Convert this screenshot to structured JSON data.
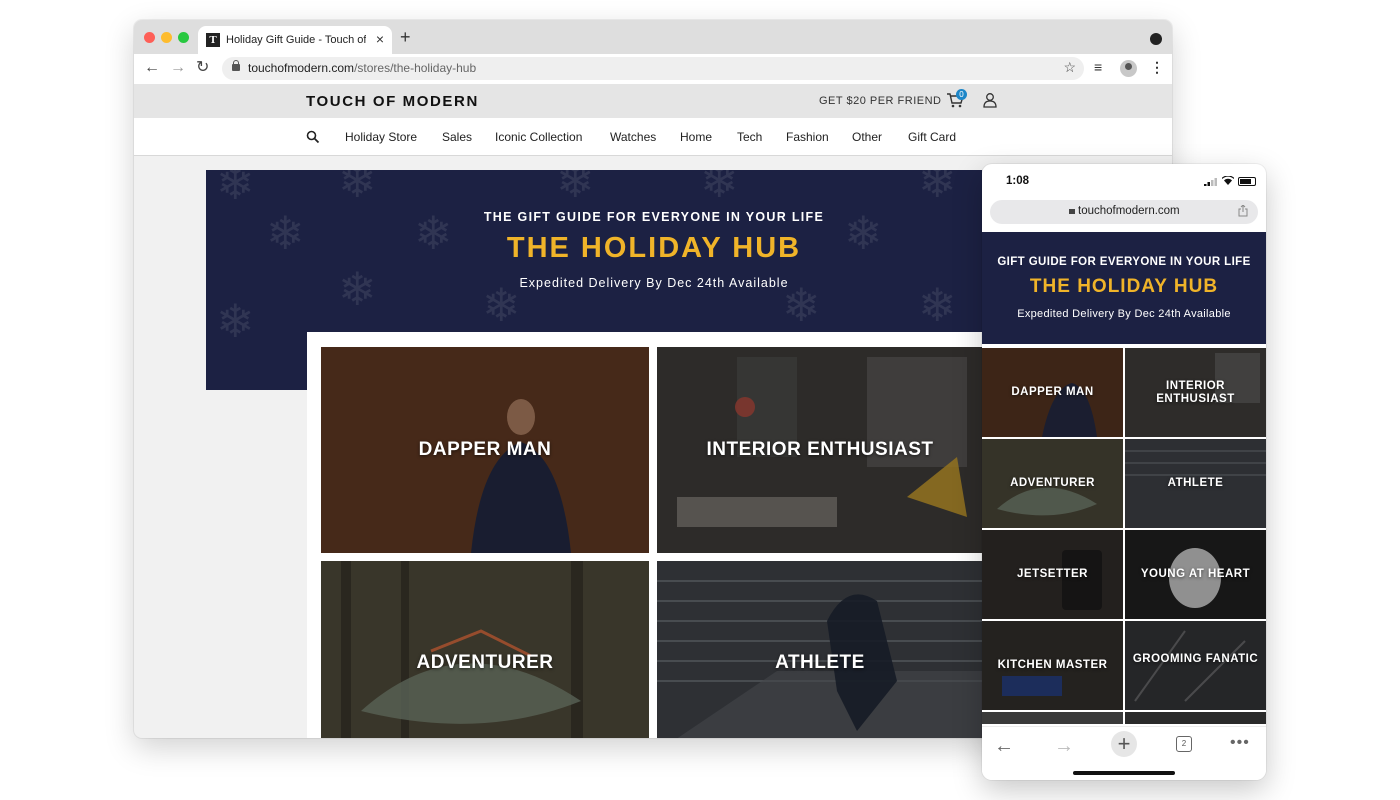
{
  "browser": {
    "tab_title": "Holiday Gift Guide - Touch of M",
    "tab_favicon": "T",
    "url_domain": "touchofmodern.com",
    "url_path": "/stores/the-holiday-hub"
  },
  "site": {
    "logo": "TOUCH OF MODERN",
    "referral": "GET $20 PER FRIEND",
    "cart_count": "0",
    "nav": [
      "Holiday Store",
      "Sales",
      "Iconic Collection",
      "Watches",
      "Home",
      "Tech",
      "Fashion",
      "Other",
      "Gift Card"
    ]
  },
  "hero": {
    "kicker": "THE GIFT GUIDE FOR EVERYONE IN YOUR LIFE",
    "title": "THE HOLIDAY HUB",
    "subtitle": "Expedited Delivery By Dec 24th Available"
  },
  "categories": [
    {
      "label": "DAPPER MAN",
      "color": "#5a3520"
    },
    {
      "label": "INTERIOR ENTHUSIAST",
      "color": "#3c3a37"
    },
    {
      "label": "ADVENTURER",
      "color": "#4a4636"
    },
    {
      "label": "ATHLETE",
      "color": "#3a3d42"
    }
  ],
  "phone": {
    "time": "1:08",
    "url": "touchofmodern.com",
    "hero": {
      "kicker": "GIFT GUIDE FOR EVERYONE IN YOUR LIFE",
      "title": "THE HOLIDAY HUB",
      "subtitle": "Expedited Delivery By Dec 24th Available"
    },
    "tiles": [
      {
        "label": "DAPPER MAN",
        "color": "#4d2f1d"
      },
      {
        "label": "INTERIOR ENTHUSIAST",
        "color": "#3a3835"
      },
      {
        "label": "ADVENTURER",
        "color": "#434033"
      },
      {
        "label": "ATHLETE",
        "color": "#35383d"
      },
      {
        "label": "JETSETTER",
        "color": "#2a2624"
      },
      {
        "label": "YOUNG AT HEART",
        "color": "#1c1c1c"
      },
      {
        "label": "KITCHEN MASTER",
        "color": "#2b2825"
      },
      {
        "label": "GROOMING FANATIC",
        "color": "#2c2d2f"
      }
    ],
    "tab_count": "2"
  },
  "colors": {
    "navy": "#1c2143",
    "gold": "#f0b429",
    "badge": "#1d86c8"
  }
}
